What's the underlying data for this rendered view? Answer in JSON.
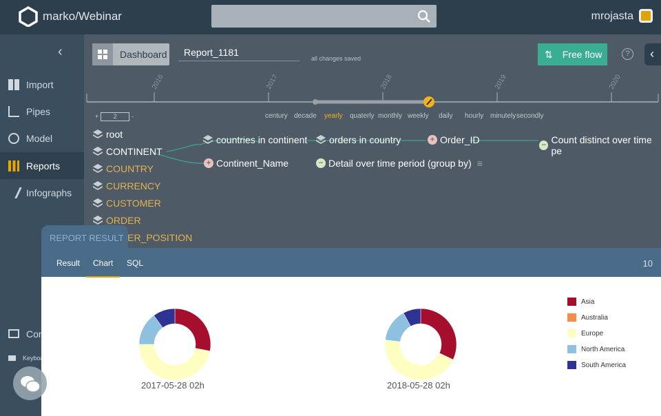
{
  "header": {
    "app_title": "marko/Webinar",
    "username": "mrojasta"
  },
  "sidebar": {
    "items": [
      {
        "label": "Import"
      },
      {
        "label": "Pipes"
      },
      {
        "label": "Model"
      },
      {
        "label": "Reports"
      },
      {
        "label": "Infographs"
      },
      {
        "label": "Con"
      },
      {
        "label": "Keyboa"
      }
    ]
  },
  "toolbar": {
    "dashboard": "Dashboard",
    "report_name": "Report_1181",
    "saved": "all changes saved",
    "free_flow": "Free flow",
    "help": "?"
  },
  "timeline": {
    "years": [
      "2016",
      "2017",
      "2018",
      "2019",
      "2020"
    ],
    "granularities": [
      "century",
      "decade",
      "yearly",
      "quaterly",
      "monthly",
      "weekly",
      "daily",
      "hourly",
      "minutely",
      "secondly"
    ],
    "selected": "yearly",
    "level": "2",
    "plus": "+",
    "minus": "-"
  },
  "tree": {
    "roots": [
      "root",
      "CONTINENT",
      "COUNTRY",
      "CURRENCY",
      "CUSTOMER",
      "ORDER",
      "ORDER_POSITION"
    ],
    "nodes": [
      "countries in continent",
      "orders in country",
      "Order_ID",
      "Count distinct over time pe",
      "Continent_Name",
      "Detail over time period (group by)"
    ]
  },
  "report": {
    "title": "REPORT RESULT",
    "tabs": [
      "Result",
      "Chart",
      "SQL"
    ],
    "active_tab": "Chart",
    "count": "10"
  },
  "chart_data": {
    "type": "pie",
    "donut": true,
    "legend": [
      {
        "name": "Asia",
        "color": "#a50f2d"
      },
      {
        "name": "Australia",
        "color": "#f58c4c"
      },
      {
        "name": "Europe",
        "color": "#fefec0"
      },
      {
        "name": "North America",
        "color": "#8ec1e0"
      },
      {
        "name": "South America",
        "color": "#2e3393"
      }
    ],
    "charts": [
      {
        "label": "2017-05-28 02h",
        "values": [
          28,
          0,
          47,
          15,
          10
        ]
      },
      {
        "label": "2018-05-28 02h",
        "values": [
          32,
          0,
          45,
          15,
          8
        ]
      }
    ],
    "legend_position": "right"
  }
}
